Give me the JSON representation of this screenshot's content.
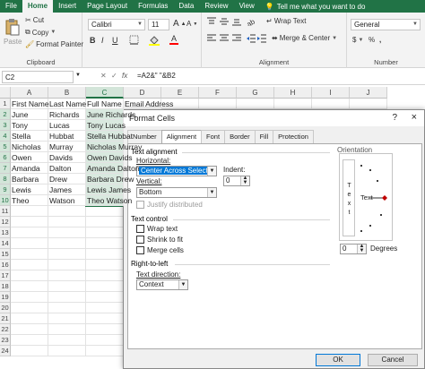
{
  "ribbon_tabs": [
    "File",
    "Home",
    "Insert",
    "Page Layout",
    "Formulas",
    "Data",
    "Review",
    "View"
  ],
  "active_tab": "Home",
  "tell_me": "Tell me what you want to do",
  "clipboard": {
    "cut": "Cut",
    "copy": "Copy",
    "paste": "Paste",
    "format_painter": "Format Painter",
    "label": "Clipboard"
  },
  "font": {
    "name": "Calibri",
    "size": "11",
    "bold": "B",
    "italic": "I",
    "underline": "U",
    "grow": "A",
    "shrink": "A",
    "font_color_letter": "A"
  },
  "alignment": {
    "wrap_text": "Wrap Text",
    "merge_center": "Merge & Center",
    "label": "Alignment"
  },
  "number": {
    "format": "General",
    "percent": "%",
    "comma": ",",
    "currency": "$",
    "label": "Number"
  },
  "formula_bar": {
    "name_box": "C2",
    "fx": "fx",
    "formula": "=A2&\" \"&B2"
  },
  "grid": {
    "columns": [
      "A",
      "B",
      "C",
      "D",
      "E",
      "F",
      "G",
      "H",
      "I",
      "J"
    ],
    "rows": [
      "1",
      "2",
      "3",
      "4",
      "5",
      "6",
      "7",
      "8",
      "9",
      "10",
      "11",
      "12",
      "13",
      "14",
      "15",
      "16",
      "17",
      "18",
      "19",
      "20",
      "21",
      "22",
      "23",
      "24"
    ],
    "data": [
      [
        "First Name",
        "Last Name",
        "Full Name",
        "Email Address"
      ],
      [
        "June",
        "Richards",
        "June Richards",
        ""
      ],
      [
        "Tony",
        "Lucas",
        "Tony Lucas",
        ""
      ],
      [
        "Stella",
        "Hubbat",
        "Stella Hubbat",
        ""
      ],
      [
        "Nicholas",
        "Murray",
        "Nicholas Murray",
        ""
      ],
      [
        "Owen",
        "Davids",
        "Owen Davids",
        ""
      ],
      [
        "Amanda",
        "Dalton",
        "Amanda Dalton",
        ""
      ],
      [
        "Barbara",
        "Drew",
        "Barbara Drew",
        ""
      ],
      [
        "Lewis",
        "James",
        "Lewis James",
        ""
      ],
      [
        "Theo",
        "Watson",
        "Theo Watson",
        ""
      ]
    ]
  },
  "dialog": {
    "title": "Format Cells",
    "help": "?",
    "close": "×",
    "tabs": [
      "Number",
      "Alignment",
      "Font",
      "Border",
      "Fill",
      "Protection"
    ],
    "active_tab": "Alignment",
    "text_alignment": "Text alignment",
    "horizontal_label": "Horizontal:",
    "horizontal_value": "Center Across Selection",
    "indent_label": "Indent:",
    "indent_value": "0",
    "vertical_label": "Vertical:",
    "vertical_value": "Bottom",
    "justify_distributed": "Justify distributed",
    "text_control": "Text control",
    "wrap_text": "Wrap text",
    "shrink_to_fit": "Shrink to fit",
    "merge_cells": "Merge cells",
    "right_to_left": "Right-to-left",
    "text_direction_label": "Text direction:",
    "text_direction_value": "Context",
    "orientation": "Orientation",
    "orientation_vertical_text": "T e x t",
    "orientation_text": "Text",
    "degrees_value": "0",
    "degrees_label": "Degrees",
    "ok": "OK",
    "cancel": "Cancel"
  },
  "colors": {
    "excel_green": "#217346",
    "selection_fill": "#d9e9df",
    "accent_red": "#c00000"
  }
}
